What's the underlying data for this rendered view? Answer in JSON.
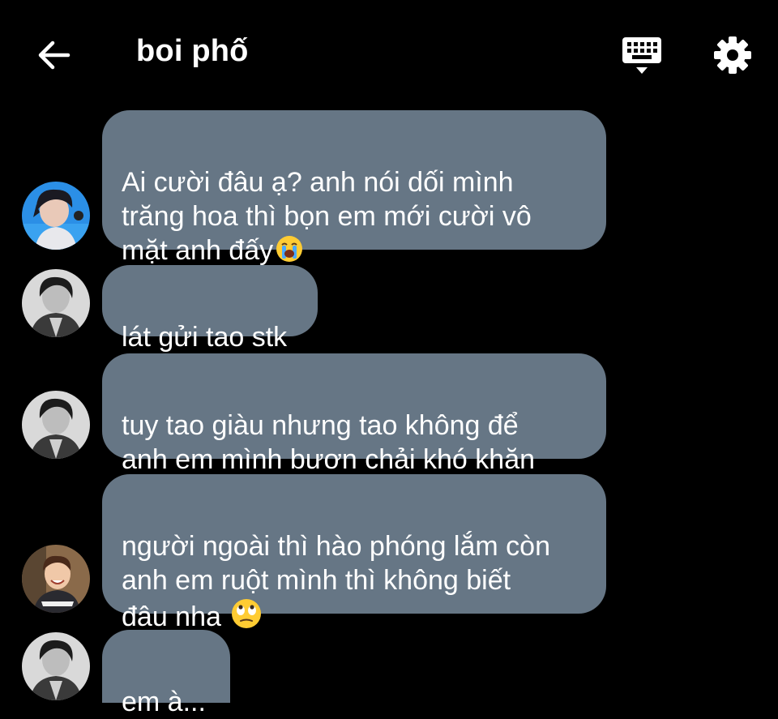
{
  "header": {
    "title": "boi phố",
    "back_icon": "arrow-left-icon",
    "keyboard_icon": "keyboard-icon",
    "settings_icon": "gear-icon"
  },
  "colors": {
    "background": "#000000",
    "bubble": "#667685",
    "text": "#ffffff"
  },
  "messages": [
    {
      "text": "Ai cười đâu ạ? anh nói dối mình\ntrăng hoa thì bọn em mới cười vô\nmặt anh đấy",
      "emoji": "crying-face",
      "avatar": "avatar-blue-bg"
    },
    {
      "text": "lát gửi tao stk",
      "avatar": "avatar-bw"
    },
    {
      "text": "tuy tao giàu nhưng tao không để\nanh em mình bươn chải khó khăn",
      "avatar": "avatar-bw"
    },
    {
      "text": "người ngoài thì hào phóng lắm còn\nanh em ruột mình thì không biết\nđâu nha ",
      "emoji": "eye-roll-face",
      "avatar": "avatar-color"
    },
    {
      "text": "em à...",
      "avatar": "avatar-bw"
    }
  ]
}
